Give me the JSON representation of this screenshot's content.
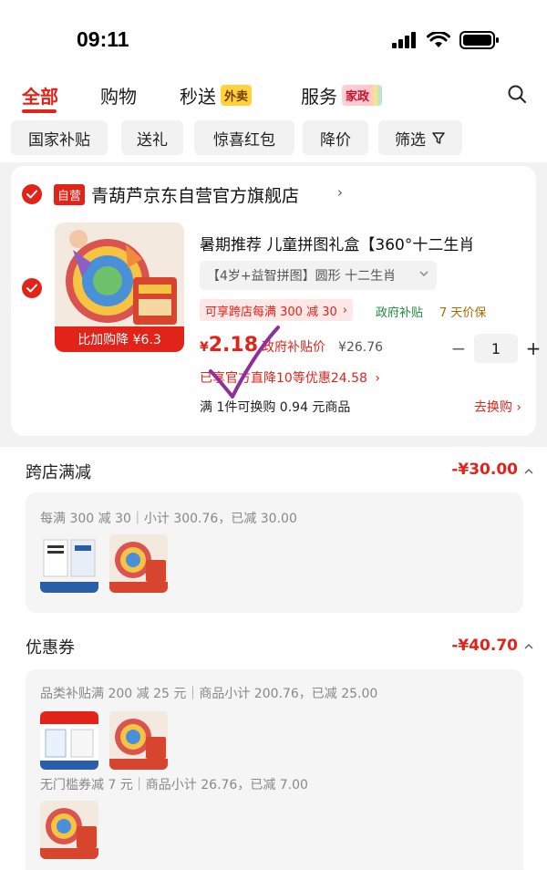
{
  "status_bar": {
    "time": "09:11"
  },
  "tabs": [
    {
      "label": "全部"
    },
    {
      "label": "购物"
    },
    {
      "label": "秒送",
      "tag": "外卖"
    },
    {
      "label": "服务",
      "tag": "家政"
    }
  ],
  "filters": [
    "国家补贴",
    "送礼",
    "惊喜红包",
    "降价",
    "筛选"
  ],
  "store": {
    "badge": "自营",
    "name": "青葫芦京东自营官方旗舰店",
    "arrow": "›"
  },
  "product": {
    "image_banner": "比加购降 ¥6.3",
    "title": "暑期推荐 儿童拼图礼盒【360°十二生肖",
    "variant": "【4岁+益智拼图】圆形 十二生肖",
    "promo": "可享跨店每满 300 减 30",
    "gov_subsidy": "政府补贴",
    "guarantee": "7 天价保",
    "price_symbol": "¥",
    "price": "2.18",
    "price_label": "政府补贴价",
    "original_price": "¥26.76",
    "quantity": "1",
    "discount_line": "已享官方直降10等优惠24.58",
    "exchange_line": "满 1件可换购 0.94 元商品",
    "exchange_link": "去换购 ›"
  },
  "summary": {
    "cross_store": {
      "title": "跨店满减",
      "amount": "-¥30.00",
      "detail": "每满 300 减 30｜小计 300.76，已减 30.00",
      "mini_labels": [
        "跨年挑战 全新升级",
        "比加购降"
      ]
    },
    "coupon": {
      "title": "优惠券",
      "amount": "-¥40.70",
      "detail1": "品类补贴满 200 减 25 元｜商品小计 200.76，已减 25.00",
      "detail2": "无门槛券减 7 元｜商品小计 26.76，已减 7.00",
      "mini_label_1": "医用级"
    }
  },
  "colors": {
    "accent": "#e2231a",
    "green": "#1a8c3a",
    "gold": "#a36b00",
    "ink": "#8f2f9c"
  }
}
